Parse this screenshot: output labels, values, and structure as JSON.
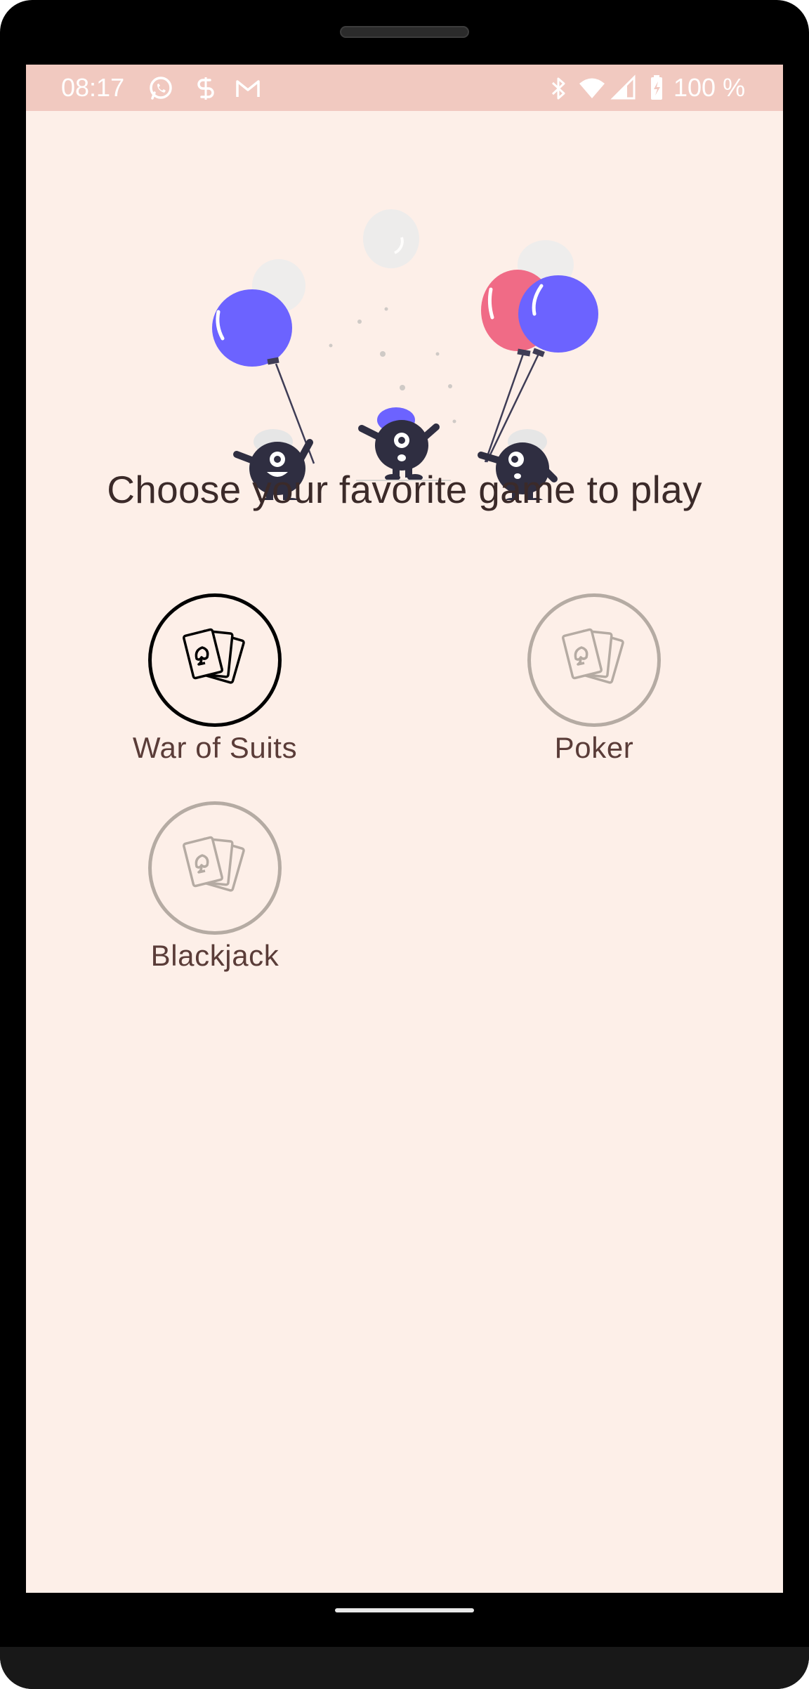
{
  "status_bar": {
    "time": "08:17",
    "battery_text": "100 %",
    "icons": [
      "whatsapp-icon",
      "s-app-icon",
      "gmail-icon",
      "bluetooth-icon",
      "wifi-icon",
      "signal-icon",
      "battery-icon"
    ]
  },
  "header": {
    "title": "Choose your favorite game to play"
  },
  "games": [
    {
      "label": "War of Suits",
      "selected": true,
      "icon": "playing-cards-icon"
    },
    {
      "label": "Poker",
      "selected": false,
      "icon": "playing-cards-icon"
    },
    {
      "label": "Blackjack",
      "selected": false,
      "icon": "playing-cards-icon"
    }
  ],
  "colors": {
    "screen_background": "#fdefe8",
    "status_bar": "#f1c9c0",
    "selected_ring": "#000000",
    "unselected_ring": "#b5aba3",
    "balloon_blue": "#6c63ff",
    "balloon_pink": "#f06b86"
  }
}
